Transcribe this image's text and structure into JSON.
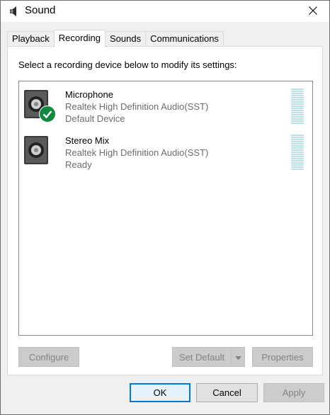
{
  "window": {
    "title": "Sound",
    "icon": "speaker-icon",
    "close_icon": "close-icon"
  },
  "tabs": [
    {
      "label": "Playback",
      "active": false
    },
    {
      "label": "Recording",
      "active": true
    },
    {
      "label": "Sounds",
      "active": false
    },
    {
      "label": "Communications",
      "active": false
    }
  ],
  "panel": {
    "instruction": "Select a recording device below to modify its settings:",
    "devices": [
      {
        "name": "Microphone",
        "driver": "Realtek High Definition Audio(SST)",
        "status": "Default Device",
        "icon": "microphone-device-icon",
        "badge": "default-check-icon"
      },
      {
        "name": "Stereo Mix",
        "driver": "Realtek High Definition Audio(SST)",
        "status": "Ready",
        "icon": "stereo-mix-device-icon"
      }
    ],
    "buttons": {
      "configure": "Configure",
      "set_default": "Set Default",
      "properties": "Properties"
    }
  },
  "footer": {
    "ok": "OK",
    "cancel": "Cancel",
    "apply": "Apply"
  },
  "colors": {
    "accent": "#0078d7",
    "check_green": "#10893e",
    "meter": "#bde0ea"
  }
}
